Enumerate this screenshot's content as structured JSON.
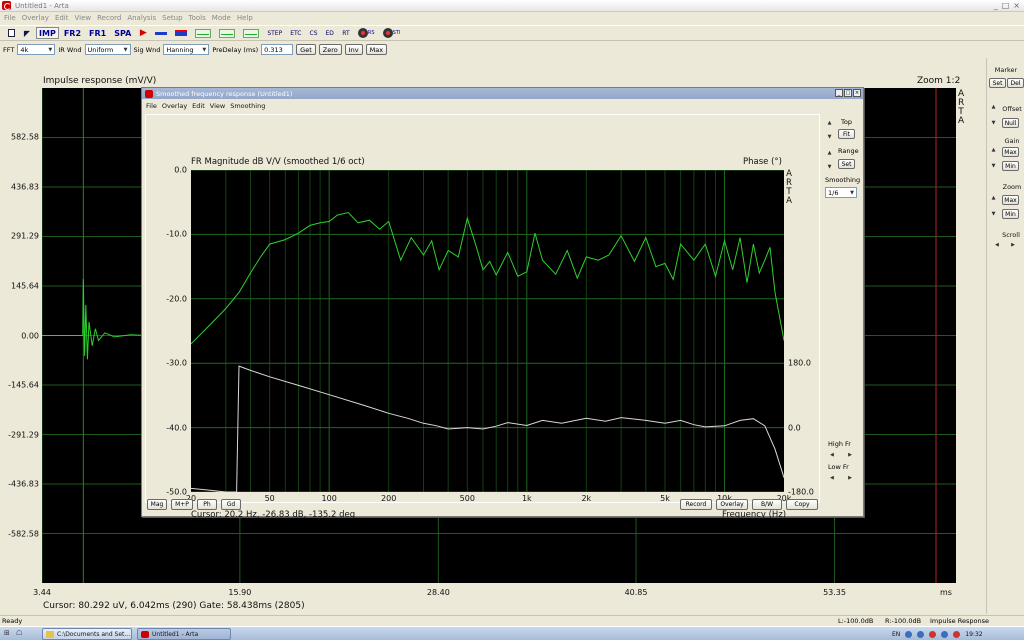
{
  "app": {
    "window_title": "Untitled1 - Arta",
    "menu": [
      "File",
      "Overlay",
      "Edit",
      "View",
      "Record",
      "Analysis",
      "Setup",
      "Tools",
      "Mode",
      "Help"
    ],
    "window_controls": [
      "_",
      "□",
      "×"
    ]
  },
  "toolbar1": {
    "imp": "IMP",
    "fr2": "FR2",
    "fr1": "FR1",
    "spa": "SPA",
    "step": "STEP",
    "etc": "ETC",
    "cs": "CS",
    "ed": "ED",
    "rt": "RT",
    "rs": "RS",
    "sti": "STI"
  },
  "toolbar2": {
    "fft_label": "FFT",
    "fft_value": "4k",
    "ir_wnd_label": "IR Wnd",
    "ir_wnd_value": "Uniform",
    "sig_wnd_label": "Sig Wnd",
    "sig_wnd_value": "Hanning",
    "predelay_label": "PreDelay (ms)",
    "predelay_value": "0.313",
    "get": "Get",
    "zero": "Zero",
    "inv": "Inv",
    "max": "Max"
  },
  "impulse_plot": {
    "title": "Impulse response (mV/V)",
    "zoom": "Zoom 1:2",
    "arta": "A\nR\nT\nA",
    "y_ticks": [
      "582.58",
      "436.83",
      "291.29",
      "145.64",
      "0.00",
      "-145.64",
      "-291.29",
      "-436.83",
      "-582.58"
    ],
    "x_ticks": [
      "3.44",
      "15.90",
      "28.40",
      "40.85",
      "53.35"
    ],
    "x_unit": "ms",
    "cursor_text": "Cursor: 80.292 uV, 6.042ms (290)  Gate: 58.438ms (2805)",
    "colors": {
      "grid": "#1f5a1f",
      "trace": "#2fcf2f",
      "marker_red": "#b22222"
    }
  },
  "right_panel": {
    "marker_label": "Marker",
    "marker_set": "Set",
    "marker_del": "Del",
    "offset_label": "Offset",
    "offset_null": "Null",
    "gain_label": "Gain",
    "gain_max": "Max",
    "gain_min": "Min",
    "zoom_label": "Zoom",
    "zoom_max": "Max",
    "zoom_min": "Min",
    "scroll_label": "Scroll"
  },
  "fr_window": {
    "title": "Smoothed frequency response (Untitled1)",
    "menu": [
      "File",
      "Overlay",
      "Edit",
      "View",
      "Smoothing"
    ],
    "plot_title": "FR Magnitude dB V/V (smoothed 1/6 oct)",
    "phase_title": "Phase (°)",
    "arta": "A\nR\nT\nA",
    "y_ticks": [
      "0.0",
      "-10.0",
      "-20.0",
      "-30.0",
      "-40.0",
      "-50.0"
    ],
    "phase_ticks": [
      "180.0",
      "0.0",
      "-180.0"
    ],
    "x_ticks": [
      "20",
      "50",
      "100",
      "200",
      "500",
      "1k",
      "2k",
      "5k",
      "10k",
      "20k"
    ],
    "x_unit": "Frequency (Hz)",
    "cursor_text": "Cursor: 20.2 Hz, -26.83 dB, -135.2 deg",
    "side": {
      "top_label": "Top",
      "fit": "Fit",
      "range_label": "Range",
      "set": "Set",
      "smoothing_label": "Smoothing",
      "smoothing_value": "1/6",
      "high_fr": "High Fr",
      "low_fr": "Low Fr"
    },
    "bottom_left": [
      "Mag",
      "M+P",
      "Ph",
      "Gd"
    ],
    "bottom_right": [
      "Record",
      "Overlay",
      "B/W",
      "Copy"
    ],
    "colors": {
      "grid": "#1f6a1f",
      "magnitude": "#2fd02f",
      "phase": "#d8d8d8"
    }
  },
  "chart_data": [
    {
      "type": "line",
      "title": "FR Magnitude dB V/V (smoothed 1/6 oct)",
      "xlabel": "Frequency (Hz)",
      "ylabel": "",
      "x_scale": "log",
      "xlim": [
        20,
        20000
      ],
      "ylim": [
        -50,
        0
      ],
      "y2lim": [
        -180,
        180
      ],
      "series": [
        {
          "axis": "left",
          "x": [
            20,
            25,
            30,
            35,
            40,
            45,
            50,
            60,
            70,
            80,
            90,
            100,
            110,
            125,
            140,
            160,
            180,
            200,
            230,
            260,
            300,
            330,
            360,
            400,
            450,
            500,
            550,
            600,
            650,
            700,
            800,
            900,
            1000,
            1100,
            1200,
            1400,
            1600,
            1800,
            2000,
            2300,
            2600,
            3000,
            3500,
            4000,
            4500,
            5000,
            5500,
            6000,
            7000,
            8000,
            9000,
            10000,
            11000,
            12000,
            13000,
            14000,
            15000,
            16000,
            17000,
            18000,
            20000
          ],
          "values": [
            -27,
            -24,
            -21.5,
            -19,
            -16,
            -13.5,
            -11.5,
            -10.8,
            -9.8,
            -8.6,
            -8.2,
            -8.0,
            -7.0,
            -6.6,
            -8.2,
            -7.8,
            -9.2,
            -8.0,
            -14.0,
            -10.5,
            -13.2,
            -11.0,
            -15.5,
            -12.5,
            -13.5,
            -7.5,
            -11.5,
            -15.5,
            -14.2,
            -16.3,
            -12.8,
            -16.5,
            -15.8,
            -9.8,
            -14.0,
            -16.2,
            -12.5,
            -16.8,
            -13.5,
            -14.0,
            -13.2,
            -10.2,
            -14.2,
            -10.5,
            -15.0,
            -14.5,
            -17.0,
            -11.5,
            -14.0,
            -11.5,
            -16.5,
            -11.0,
            -15.5,
            -10.5,
            -17.5,
            -11.5,
            -16.0,
            -14.0,
            -12.0,
            -19.0,
            -26.5
          ]
        },
        {
          "axis": "right",
          "x": [
            20,
            25,
            30,
            34,
            35,
            40,
            50,
            70,
            100,
            150,
            200,
            250,
            300,
            350,
            400,
            500,
            600,
            700,
            800,
            1000,
            1200,
            1500,
            2000,
            2500,
            3000,
            4000,
            5000,
            6000,
            7000,
            8000,
            10000,
            12000,
            14000,
            16000,
            18000,
            20000
          ],
          "values": [
            -170,
            -175,
            -180,
            -180,
            172,
            160,
            142,
            118,
            92,
            62,
            40,
            26,
            12,
            5,
            -4,
            0,
            -4,
            4,
            14,
            6,
            20,
            12,
            26,
            18,
            28,
            20,
            12,
            20,
            8,
            2,
            5,
            20,
            25,
            5,
            -60,
            -140
          ]
        }
      ]
    },
    {
      "type": "line",
      "title": "Impulse response (mV/V)",
      "xlabel": "ms",
      "ylabel": "",
      "xlim": [
        3.44,
        61.0
      ],
      "ylim": [
        -728.2,
        728.2
      ],
      "series": [
        {
          "x": [
            3.44,
            6.0,
            6.04,
            6.12,
            6.2,
            6.3,
            6.4,
            6.6,
            6.8,
            7.0,
            7.4,
            8.0,
            9.0,
            10.0
          ],
          "values": [
            0,
            0,
            166,
            -60,
            90,
            -70,
            40,
            -30,
            20,
            -15,
            8,
            -4,
            2,
            0
          ]
        }
      ]
    }
  ],
  "status": {
    "left": "Ready",
    "l_level": "L:-100.0dB",
    "r_level": "R:-100.0dB",
    "mode": "Impulse Response"
  },
  "taskbar": {
    "task1": "C:\\Documents and Set...",
    "task2": "Untitled1 - Arta",
    "lang": "EN",
    "time": "19:32"
  }
}
